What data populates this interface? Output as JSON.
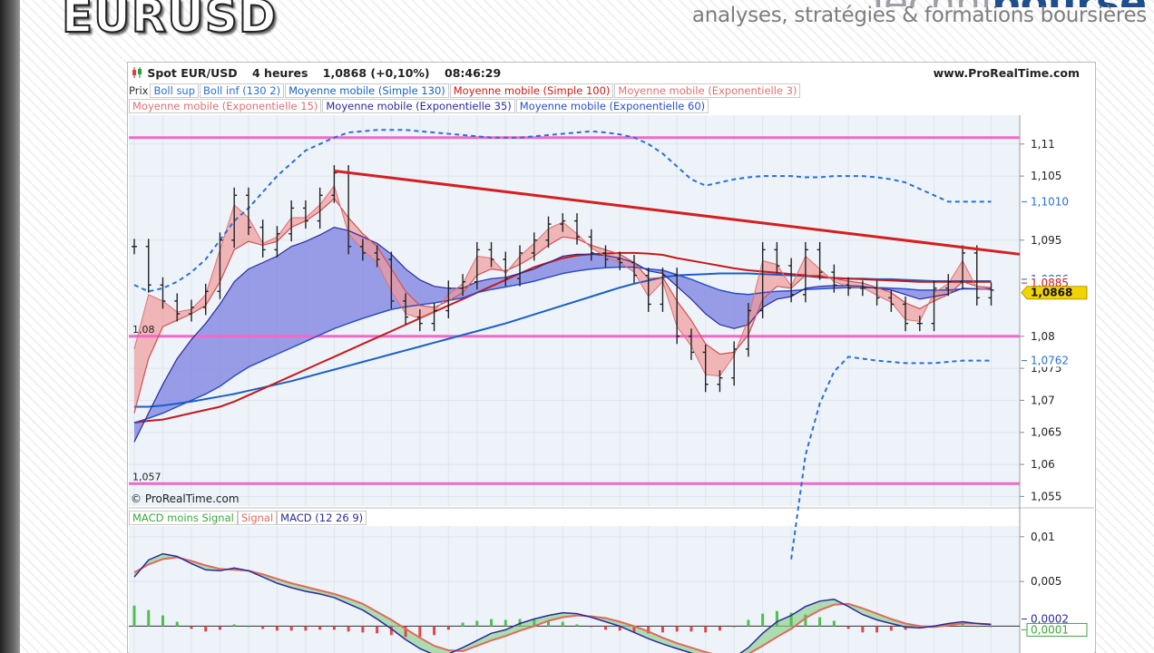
{
  "slide": {
    "title": "EURUSD",
    "brand_light": "Techni",
    "brand_bold": "bourse",
    "tagline": "analyses, stratégies & formations boursières"
  },
  "header": {
    "instrument": "Spot EUR/USD",
    "timeframe": "4 heures",
    "price": "1,0868 (+0,10%)",
    "time": "08:46:29",
    "site": "www.ProRealTime.com"
  },
  "legend": {
    "row1": [
      {
        "label": "Prix",
        "color": "#333333",
        "framed": false
      },
      {
        "label": "Boll sup",
        "color": "#2a6fd6"
      },
      {
        "label": "Boll inf (130 2)",
        "color": "#2a6fd6"
      },
      {
        "label": "Moyenne mobile (Simple 130)",
        "color": "#1a5fc8"
      },
      {
        "label": "Moyenne mobile (Simple 100)",
        "color": "#d01818"
      },
      {
        "label": "Moyenne mobile (Exponentielle 3)",
        "color": "#e07070"
      }
    ],
    "row2": [
      {
        "label": "Moyenne mobile (Exponentielle 15)",
        "color": "#e07070"
      },
      {
        "label": "Moyenne mobile (Exponentielle 35)",
        "color": "#2a2a9a"
      },
      {
        "label": "Moyenne mobile (Exponentielle 60)",
        "color": "#2a4fc8"
      }
    ]
  },
  "copyright": "© ProRealTime.com",
  "macd_legend": [
    {
      "label": "MACD moins Signal",
      "color": "#3aa83a"
    },
    {
      "label": "Signal",
      "color": "#e06a5a"
    },
    {
      "label": "MACD (12 26 9)",
      "color": "#2a2a9a"
    }
  ],
  "chart_data": [
    {
      "type": "line",
      "title": "Spot EUR/USD 4 heures",
      "ylim": [
        1.0535,
        1.1145
      ],
      "y_ticks": [
        "1,11",
        "1,105",
        "1,095",
        "1,08",
        "1,075",
        "1,07",
        "1,065",
        "1,06",
        "1,055"
      ],
      "y_tick_values": [
        1.11,
        1.105,
        1.095,
        1.08,
        1.075,
        1.07,
        1.065,
        1.06,
        1.055
      ],
      "x": [
        0,
        4,
        8,
        12,
        16,
        20,
        24,
        28,
        32,
        36,
        40,
        44,
        48,
        52,
        56,
        60,
        64,
        68,
        72,
        76,
        80,
        84,
        88,
        92,
        96,
        100,
        104,
        108,
        112,
        116,
        120,
        124,
        128,
        132,
        136,
        140,
        144,
        148,
        152,
        156,
        160,
        164,
        168,
        172,
        176,
        180,
        184,
        188,
        192,
        196,
        200,
        204,
        208,
        212,
        216,
        220,
        224,
        228,
        232,
        236,
        240
      ],
      "price": [
        1.094,
        1.088,
        1.0855,
        1.0835,
        1.0845,
        1.087,
        1.095,
        1.102,
        1.097,
        1.0935,
        1.096,
        1.1,
        1.098,
        1.102,
        1.1055,
        1.094,
        1.093,
        1.092,
        1.0855,
        1.083,
        1.082,
        1.084,
        1.0875,
        1.0885,
        1.0935,
        1.092,
        1.089,
        1.093,
        1.095,
        1.0975,
        1.098,
        1.0955,
        1.093,
        1.092,
        1.0915,
        1.0895,
        1.085,
        1.0895,
        1.08,
        1.0775,
        1.0725,
        1.0735,
        1.078,
        1.084,
        1.0935,
        1.091,
        1.0865,
        1.0935,
        1.09,
        1.088,
        1.0875,
        1.0875,
        1.086,
        1.085,
        1.082,
        1.082,
        1.0875,
        1.0885,
        1.093,
        1.086,
        1.0872
      ],
      "ema3": [
        1.078,
        1.0865,
        1.0855,
        1.0838,
        1.0842,
        1.0865,
        1.0935,
        1.1005,
        1.0985,
        1.0945,
        1.0955,
        1.0985,
        1.0985,
        1.1005,
        1.1035,
        1.096,
        1.0935,
        1.0915,
        1.087,
        1.0835,
        1.0828,
        1.0838,
        1.0865,
        1.0882,
        1.0925,
        1.0922,
        1.0898,
        1.0925,
        1.0945,
        1.0968,
        1.0978,
        1.096,
        1.0938,
        1.0925,
        1.0915,
        1.09,
        1.0862,
        1.0885,
        1.0815,
        1.0785,
        1.074,
        1.0738,
        1.077,
        1.0828,
        1.0918,
        1.0912,
        1.0878,
        1.0925,
        1.0905,
        1.0885,
        1.0878,
        1.0876,
        1.0864,
        1.0853,
        1.0826,
        1.0823,
        1.0868,
        1.0882,
        1.0918,
        1.0875,
        1.0872
      ],
      "ema15": [
        1.068,
        1.0765,
        1.0815,
        1.0825,
        1.0835,
        1.0848,
        1.0885,
        1.0935,
        1.0948,
        1.0942,
        1.0948,
        1.097,
        1.098,
        1.0995,
        1.1015,
        1.0985,
        1.096,
        1.094,
        1.0905,
        1.087,
        1.0848,
        1.0845,
        1.0855,
        1.0868,
        1.0895,
        1.0905,
        1.0902,
        1.0912,
        1.0925,
        1.0942,
        1.0955,
        1.0952,
        1.0942,
        1.0935,
        1.0928,
        1.0915,
        1.089,
        1.0892,
        1.0855,
        1.0825,
        1.0788,
        1.0772,
        1.0775,
        1.0802,
        1.0858,
        1.0878,
        1.0875,
        1.0895,
        1.0895,
        1.089,
        1.0886,
        1.0883,
        1.0876,
        1.0868,
        1.0852,
        1.0843,
        1.0855,
        1.0865,
        1.0885,
        1.0878,
        1.0876
      ],
      "ema35": [
        1.0635,
        1.068,
        1.0725,
        1.0765,
        1.0795,
        1.082,
        1.085,
        1.0885,
        1.0905,
        1.0915,
        1.0925,
        1.094,
        1.0948,
        1.0958,
        1.097,
        1.0965,
        1.0955,
        1.0945,
        1.0928,
        1.0905,
        1.0888,
        1.0878,
        1.0875,
        1.0875,
        1.0885,
        1.089,
        1.0892,
        1.0898,
        1.0905,
        1.0915,
        1.0925,
        1.0928,
        1.0928,
        1.0926,
        1.0922,
        1.0915,
        1.0902,
        1.0898,
        1.0878,
        1.0858,
        1.0835,
        1.0818,
        1.0812,
        1.0818,
        1.0845,
        1.0858,
        1.0862,
        1.0875,
        1.0878,
        1.0879,
        1.0879,
        1.0878,
        1.0875,
        1.0872,
        1.0865,
        1.0858,
        1.0862,
        1.0866,
        1.0875,
        1.0874,
        1.0873
      ],
      "ema60": [
        1.0665,
        1.0672,
        1.068,
        1.069,
        1.07,
        1.071,
        1.0722,
        1.0738,
        1.0752,
        1.0762,
        1.0772,
        1.0782,
        1.0792,
        1.0802,
        1.0812,
        1.082,
        1.0828,
        1.0835,
        1.0842,
        1.0846,
        1.0849,
        1.0852,
        1.0856,
        1.086,
        1.0868,
        1.0873,
        1.0877,
        1.0881,
        1.0886,
        1.0892,
        1.0898,
        1.0902,
        1.0905,
        1.0907,
        1.0908,
        1.0908,
        1.0905,
        1.0903,
        1.0896,
        1.0889,
        1.088,
        1.0872,
        1.0867,
        1.0865,
        1.0868,
        1.087,
        1.0871,
        1.0873,
        1.0874,
        1.0875,
        1.0876,
        1.0876,
        1.0876,
        1.0875,
        1.0874,
        1.0872,
        1.0872,
        1.0872,
        1.0874,
        1.0874,
        1.0874
      ],
      "sma100": [
        1.0665,
        1.0668,
        1.067,
        1.0675,
        1.068,
        1.0685,
        1.069,
        1.0698,
        1.0708,
        1.0718,
        1.0728,
        1.0738,
        1.0748,
        1.0758,
        1.0768,
        1.0778,
        1.0788,
        1.0798,
        1.0808,
        1.0818,
        1.0828,
        1.0838,
        1.0848,
        1.0858,
        1.0868,
        1.0878,
        1.0888,
        1.0898,
        1.0908,
        1.0915,
        1.0922,
        1.0926,
        1.0928,
        1.0929,
        1.093,
        1.093,
        1.0929,
        1.0927,
        1.0922,
        1.0918,
        1.0914,
        1.091,
        1.0906,
        1.0903,
        1.0901,
        1.0899,
        1.0897,
        1.0895,
        1.0893,
        1.0891,
        1.089,
        1.0889,
        1.0888,
        1.0887,
        1.0886,
        1.0885,
        1.0885,
        1.0885,
        1.0885,
        1.0885,
        1.0885
      ],
      "sma130": [
        1.069,
        1.069,
        1.0692,
        1.0695,
        1.0698,
        1.0702,
        1.0706,
        1.071,
        1.0715,
        1.072,
        1.0725,
        1.073,
        1.0736,
        1.0742,
        1.0748,
        1.0754,
        1.076,
        1.0766,
        1.0772,
        1.0778,
        1.0784,
        1.079,
        1.0796,
        1.0802,
        1.0808,
        1.0814,
        1.082,
        1.0827,
        1.0834,
        1.0841,
        1.0848,
        1.0855,
        1.0862,
        1.0869,
        1.0876,
        1.0882,
        1.0887,
        1.0892,
        1.0895,
        1.0896,
        1.0897,
        1.0898,
        1.0898,
        1.0898,
        1.0897,
        1.0896,
        1.0895,
        1.0894,
        1.0892,
        1.0891,
        1.089,
        1.089,
        1.0889,
        1.0889,
        1.0888,
        1.0887,
        1.0886,
        1.0886,
        1.0886,
        1.0886,
        1.0886
      ],
      "boll_sup": [
        1.088,
        1.087,
        1.0875,
        1.0885,
        1.09,
        1.092,
        1.095,
        1.098,
        1.1,
        1.1025,
        1.105,
        1.107,
        1.109,
        1.11,
        1.111,
        1.1118,
        1.112,
        1.1122,
        1.1122,
        1.1122,
        1.112,
        1.1118,
        1.1116,
        1.1114,
        1.1112,
        1.111,
        1.111,
        1.111,
        1.1112,
        1.1114,
        1.1116,
        1.1118,
        1.112,
        1.1118,
        1.1115,
        1.111,
        1.11,
        1.1085,
        1.1065,
        1.1045,
        1.1035,
        1.104,
        1.1045,
        1.1048,
        1.105,
        1.105,
        1.105,
        1.1048,
        1.1048,
        1.105,
        1.105,
        1.105,
        1.1048,
        1.1045,
        1.104,
        1.103,
        1.102,
        1.101,
        1.101,
        1.101,
        1.101
      ],
      "boll_inf": [
        null,
        null,
        null,
        null,
        null,
        null,
        null,
        null,
        null,
        null,
        null,
        null,
        null,
        null,
        null,
        null,
        null,
        null,
        null,
        null,
        null,
        null,
        null,
        null,
        null,
        null,
        null,
        null,
        null,
        null,
        null,
        null,
        null,
        null,
        null,
        null,
        null,
        null,
        null,
        null,
        null,
        null,
        null,
        null,
        null,
        null,
        1.0452,
        1.0615,
        1.0695,
        1.0745,
        1.0768,
        1.0765,
        1.0762,
        1.076,
        1.0758,
        1.0758,
        1.0758,
        1.076,
        1.0762,
        1.0762,
        1.0762
      ],
      "horizontal_lines": [
        1.111,
        1.08,
        1.057
      ],
      "trendline": {
        "from": [
          56,
          1.1058
        ],
        "to": [
          240,
          1.0928
        ]
      },
      "labels": [
        {
          "text": "1,08",
          "y": 1.08
        },
        {
          "text": "1,057",
          "y": 1.057
        }
      ],
      "price_tags": [
        {
          "text": "1,1010",
          "y": 1.101,
          "color": "#2a6fd6",
          "style": "boll"
        },
        {
          "text": "1,0886",
          "y": 1.0889,
          "color": "#1a5fc8",
          "style": "boll"
        },
        {
          "text": "1,0885",
          "y": 1.0883,
          "color": "#d01818",
          "style": "red"
        },
        {
          "text": "1,0868",
          "y": 1.0868,
          "color": "#f2d400",
          "style": "price"
        },
        {
          "text": "1,0762",
          "y": 1.0762,
          "color": "#2a6fd6",
          "style": "boll"
        }
      ]
    },
    {
      "type": "bar",
      "title": "MACD (12 26 9)",
      "ylim": [
        -0.003,
        0.0112
      ],
      "y_ticks": [
        "0,01",
        "0,005"
      ],
      "y_tick_values": [
        0.01,
        0.005
      ],
      "x": [
        0,
        4,
        8,
        12,
        16,
        20,
        24,
        28,
        32,
        36,
        40,
        44,
        48,
        52,
        56,
        60,
        64,
        68,
        72,
        76,
        80,
        84,
        88,
        92,
        96,
        100,
        104,
        108,
        112,
        116,
        120,
        124,
        128,
        132,
        136,
        140,
        144,
        148,
        152,
        156,
        160,
        164,
        168,
        172,
        176,
        180,
        184,
        188,
        192,
        196,
        200,
        204,
        208,
        212,
        216,
        220,
        224,
        228,
        232,
        236,
        240
      ],
      "macd": [
        0.0055,
        0.0074,
        0.0081,
        0.0078,
        0.007,
        0.0063,
        0.0062,
        0.0065,
        0.0062,
        0.0055,
        0.0048,
        0.0043,
        0.0039,
        0.0036,
        0.0032,
        0.0025,
        0.0018,
        0.0008,
        -0.0003,
        -0.0015,
        -0.0025,
        -0.0032,
        -0.0031,
        -0.0024,
        -0.0016,
        -0.0008,
        -0.0004,
        0.0003,
        0.0008,
        0.0012,
        0.0015,
        0.0014,
        0.001,
        0.0005,
        0.0,
        -0.0007,
        -0.0014,
        -0.002,
        -0.0025,
        -0.003,
        -0.0036,
        -0.0038,
        -0.0035,
        -0.0024,
        -0.0008,
        0.0005,
        0.0012,
        0.0022,
        0.0028,
        0.003,
        0.0022,
        0.0013,
        0.0007,
        0.0003,
        -0.0001,
        -0.0002,
        0.0,
        0.0003,
        0.0005,
        0.0003,
        0.0002
      ],
      "signal": [
        0.006,
        0.0069,
        0.0075,
        0.0077,
        0.0073,
        0.0068,
        0.0064,
        0.0063,
        0.0062,
        0.0058,
        0.0053,
        0.0048,
        0.0044,
        0.004,
        0.0036,
        0.0031,
        0.0025,
        0.0016,
        0.0007,
        -0.0003,
        -0.0013,
        -0.0022,
        -0.0027,
        -0.0028,
        -0.0022,
        -0.0016,
        -0.0011,
        -0.0005,
        0.0,
        0.0006,
        0.001,
        0.0012,
        0.0011,
        0.0009,
        0.0005,
        0.0,
        -0.0006,
        -0.0013,
        -0.0019,
        -0.0024,
        -0.0029,
        -0.0033,
        -0.0034,
        -0.0031,
        -0.0022,
        -0.0012,
        -0.0003,
        0.0009,
        0.0018,
        0.0024,
        0.0025,
        0.002,
        0.0014,
        0.0008,
        0.0003,
        0.0,
        -0.0001,
        0.0001,
        0.0003,
        0.0003,
        0.0002
      ],
      "histogram": [
        0.0023,
        0.0018,
        0.0012,
        0.0005,
        -0.0003,
        -0.0006,
        -0.0004,
        0.0002,
        0.0,
        -0.0003,
        -0.0005,
        -0.0005,
        -0.0005,
        -0.0004,
        -0.0004,
        -0.0006,
        -0.0007,
        -0.0008,
        -0.001,
        -0.0012,
        -0.0012,
        -0.001,
        -0.0004,
        0.0004,
        0.0006,
        0.0008,
        0.0007,
        0.0008,
        0.0008,
        0.0006,
        0.0005,
        0.0002,
        -0.0001,
        -0.0004,
        -0.0005,
        -0.0007,
        -0.0008,
        -0.0007,
        -0.0006,
        -0.0006,
        -0.0007,
        -0.0005,
        -0.0001,
        0.0007,
        0.0014,
        0.0017,
        0.0015,
        0.0013,
        0.001,
        0.0006,
        -0.0003,
        -0.0007,
        -0.0007,
        -0.0005,
        -0.0004,
        -0.0002,
        0.0001,
        0.0002,
        0.0002,
        0.0,
        0.0
      ],
      "price_tags": [
        {
          "text": "0,0002",
          "y": 0.0003,
          "color": "#2a2a9a",
          "style": "boll"
        },
        {
          "text": "0,0001",
          "y": 0.0001,
          "color": "#3aa83a",
          "style": "macd"
        }
      ]
    }
  ]
}
